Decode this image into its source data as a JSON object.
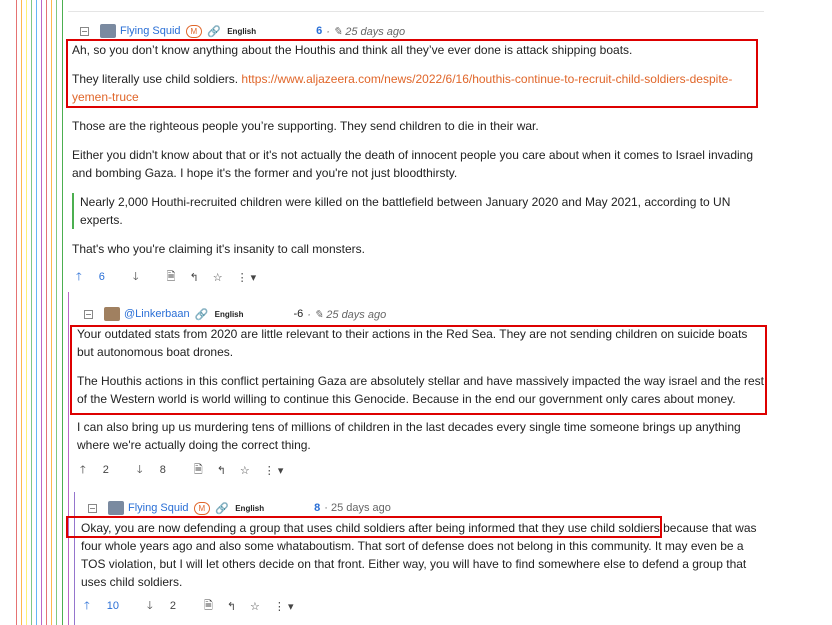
{
  "colors": {
    "link": "#2a6fd6",
    "accent": "#e0662a",
    "highlight": "#d00000",
    "quote_bar": "#4caf50"
  },
  "comments": [
    {
      "user": "Flying Squid",
      "mod_badge": "M",
      "language": "English",
      "score": "6",
      "time": "· ✎ 25 days ago",
      "paragraphs": [
        "Ah, so you don’t know anything about the Houthis and think all they’ve ever done is attack shipping boats.",
        "They literally use child soldiers.",
        "Those are the righteous people you’re supporting. They send children to die in their war.",
        "Either you didn't know about that or it's not actually the death of innocent people you care about when it comes to Israel invading and bombing Gaza. I hope it's the former and you're not just bloodthirsty.",
        "Nearly 2,000 Houthi-recruited children were killed on the battlefield between January 2020 and May 2021, according to UN experts.",
        "That's who you're claiming it's insanity to call monsters."
      ],
      "link_url": "https://www.aljazeera.com/news/2022/6/16/houthis-continue-to-recruit-child-soldiers-despite-yemen-truce",
      "upvotes": "6",
      "downvotes": ""
    },
    {
      "user": "@Linkerbaan",
      "language": "English",
      "score": "-6",
      "time": "· ✎ 25 days ago",
      "paragraphs": [
        "Your outdated stats from 2020 are little relevant to their actions in the Red Sea. They are not sending children on suicide boats but autonomous boat drones.",
        "The Houthis actions in this conflict pertaining Gaza are absolutely stellar and have massively impacted the way israel and the rest of the Western world is world willing to continue this Genocide. Because in the end our government only cares about money.",
        "I can also bring up us murdering tens of millions of children in the last decades every single time someone brings up anything where we're actually doing the correct thing."
      ],
      "upvotes": "2",
      "downvotes": "8"
    },
    {
      "user": "Flying Squid",
      "mod_badge": "M",
      "language": "English",
      "score": "8",
      "time": "· 25 days ago",
      "paragraphs": [
        "Okay, you are now defending a group that uses child soldiers after being informed that they use child soldiers because that was four whole years ago and also some whataboutism. That sort of defense does not belong in this community. It may even be a TOS violation, but I will let others decide on that front. Either way, you will have to find somewhere else to defend a group that uses child soldiers."
      ],
      "upvotes": "10",
      "downvotes": "2"
    }
  ],
  "icons": {
    "collapse": "minus-box-icon",
    "link": "link-icon",
    "up": "arrow-up-icon",
    "down": "arrow-down-icon",
    "source": "document-icon",
    "reply": "reply-icon",
    "save": "star-icon",
    "more": "more-icon"
  }
}
